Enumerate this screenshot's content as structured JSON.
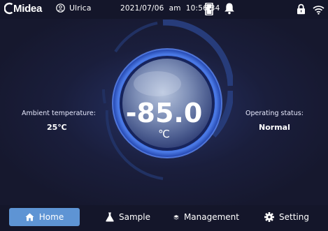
{
  "status_bar": {
    "brand": "Midea",
    "user_name": "Ulrica",
    "datetime": "2021/07/06  am  10:56:34",
    "icons": [
      "user-icon",
      "door-icon",
      "bell-icon",
      "lock-icon",
      "wifi-icon"
    ]
  },
  "main": {
    "ambient_label": "Ambient temperature:",
    "ambient_value": "25℃",
    "operating_label": "Operating status:",
    "operating_value": "Normal",
    "temperature": "-85.0",
    "temperature_unit": "℃"
  },
  "nav": {
    "items": [
      {
        "label": "Home",
        "icon": "home-icon",
        "active": true
      },
      {
        "label": "Sample",
        "icon": "flask-icon",
        "active": false
      },
      {
        "label": "Management",
        "icon": "layers-icon",
        "active": false
      },
      {
        "label": "Setting",
        "icon": "gear-icon",
        "active": false
      }
    ]
  },
  "colors": {
    "background": "#17192e",
    "accent": "#5e94d4",
    "gauge_blue": "#2d5bd1"
  }
}
